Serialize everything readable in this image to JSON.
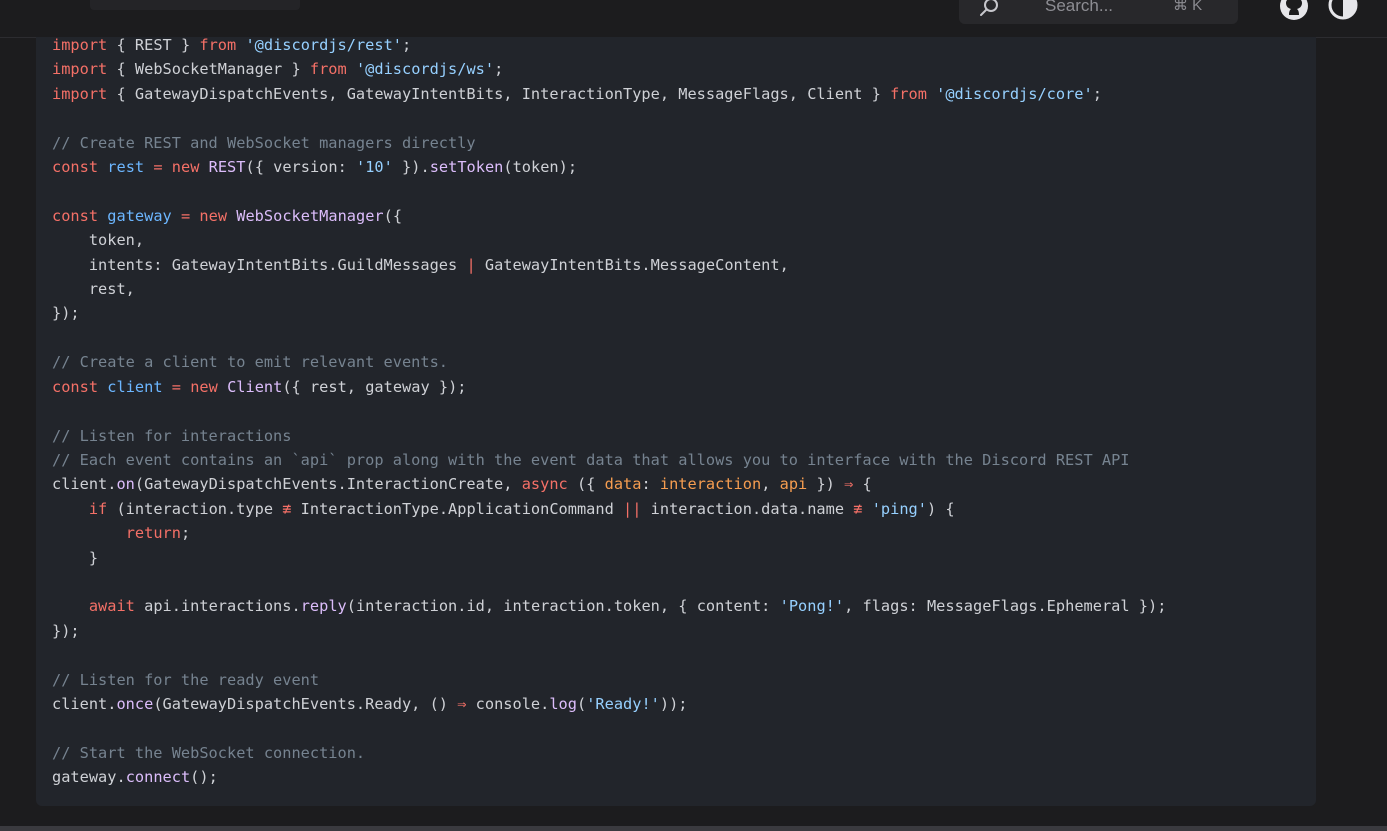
{
  "header": {
    "search_placeholder": "Search...",
    "search_shortcut": "⌘ K",
    "icons": [
      "search-icon",
      "github-icon",
      "theme-toggle-icon"
    ]
  },
  "colors": {
    "background": "#1c1c1e",
    "code_background": "#22252b",
    "keyword": "#f47067",
    "string": "#96d0ff",
    "function": "#dcbdfb",
    "variable": "#6cb6ff",
    "comment": "#768390",
    "parameter": "#f69d50",
    "text": "#cfd1d6"
  },
  "code": {
    "language": "javascript",
    "lines": [
      [
        [
          "kw",
          "import"
        ],
        [
          "plain",
          " { REST } "
        ],
        [
          "kw",
          "from"
        ],
        [
          "plain",
          " "
        ],
        [
          "str",
          "'@discordjs/rest'"
        ],
        [
          "plain",
          ";"
        ]
      ],
      [
        [
          "kw",
          "import"
        ],
        [
          "plain",
          " { WebSocketManager } "
        ],
        [
          "kw",
          "from"
        ],
        [
          "plain",
          " "
        ],
        [
          "str",
          "'@discordjs/ws'"
        ],
        [
          "plain",
          ";"
        ]
      ],
      [
        [
          "kw",
          "import"
        ],
        [
          "plain",
          " { GatewayDispatchEvents, GatewayIntentBits, InteractionType, MessageFlags, Client } "
        ],
        [
          "kw",
          "from"
        ],
        [
          "plain",
          " "
        ],
        [
          "str",
          "'@discordjs/core'"
        ],
        [
          "plain",
          ";"
        ]
      ],
      [],
      [
        [
          "cm",
          "// Create REST and WebSocket managers directly"
        ]
      ],
      [
        [
          "kw",
          "const"
        ],
        [
          "plain",
          " "
        ],
        [
          "var",
          "rest"
        ],
        [
          "plain",
          " "
        ],
        [
          "op",
          "="
        ],
        [
          "plain",
          " "
        ],
        [
          "kw",
          "new"
        ],
        [
          "plain",
          " "
        ],
        [
          "fn",
          "REST"
        ],
        [
          "plain",
          "({ version: "
        ],
        [
          "str",
          "'10'"
        ],
        [
          "plain",
          " })."
        ],
        [
          "fn",
          "setToken"
        ],
        [
          "plain",
          "(token);"
        ]
      ],
      [],
      [
        [
          "kw",
          "const"
        ],
        [
          "plain",
          " "
        ],
        [
          "var",
          "gateway"
        ],
        [
          "plain",
          " "
        ],
        [
          "op",
          "="
        ],
        [
          "plain",
          " "
        ],
        [
          "kw",
          "new"
        ],
        [
          "plain",
          " "
        ],
        [
          "fn",
          "WebSocketManager"
        ],
        [
          "plain",
          "({"
        ]
      ],
      [
        [
          "plain",
          "    token,"
        ]
      ],
      [
        [
          "plain",
          "    intents: GatewayIntentBits.GuildMessages "
        ],
        [
          "op",
          "|"
        ],
        [
          "plain",
          " GatewayIntentBits.MessageContent,"
        ]
      ],
      [
        [
          "plain",
          "    rest,"
        ]
      ],
      [
        [
          "plain",
          "});"
        ]
      ],
      [],
      [
        [
          "cm",
          "// Create a client to emit relevant events."
        ]
      ],
      [
        [
          "kw",
          "const"
        ],
        [
          "plain",
          " "
        ],
        [
          "var",
          "client"
        ],
        [
          "plain",
          " "
        ],
        [
          "op",
          "="
        ],
        [
          "plain",
          " "
        ],
        [
          "kw",
          "new"
        ],
        [
          "plain",
          " "
        ],
        [
          "fn",
          "Client"
        ],
        [
          "plain",
          "({ rest, gateway });"
        ]
      ],
      [],
      [
        [
          "cm",
          "// Listen for interactions"
        ]
      ],
      [
        [
          "cm",
          "// Each event contains an `api` prop along with the event data that allows you to interface with the Discord REST API"
        ]
      ],
      [
        [
          "plain",
          "client."
        ],
        [
          "fn",
          "on"
        ],
        [
          "plain",
          "(GatewayDispatchEvents.InteractionCreate, "
        ],
        [
          "kw",
          "async"
        ],
        [
          "plain",
          " ({ "
        ],
        [
          "param",
          "data"
        ],
        [
          "plain",
          ": "
        ],
        [
          "param",
          "interaction"
        ],
        [
          "plain",
          ", "
        ],
        [
          "param",
          "api"
        ],
        [
          "plain",
          " }) "
        ],
        [
          "op",
          "⇒"
        ],
        [
          "plain",
          " {"
        ]
      ],
      [
        [
          "plain",
          "    "
        ],
        [
          "kw",
          "if"
        ],
        [
          "plain",
          " (interaction.type "
        ],
        [
          "op",
          "≢"
        ],
        [
          "plain",
          " InteractionType.ApplicationCommand "
        ],
        [
          "op",
          "||"
        ],
        [
          "plain",
          " interaction.data.name "
        ],
        [
          "op",
          "≢"
        ],
        [
          "plain",
          " "
        ],
        [
          "str",
          "'ping'"
        ],
        [
          "plain",
          ") {"
        ]
      ],
      [
        [
          "plain",
          "        "
        ],
        [
          "kw",
          "return"
        ],
        [
          "plain",
          ";"
        ]
      ],
      [
        [
          "plain",
          "    }"
        ]
      ],
      [],
      [
        [
          "plain",
          "    "
        ],
        [
          "kw",
          "await"
        ],
        [
          "plain",
          " api.interactions."
        ],
        [
          "fn",
          "reply"
        ],
        [
          "plain",
          "(interaction.id, interaction.token, { content: "
        ],
        [
          "str",
          "'Pong!'"
        ],
        [
          "plain",
          ", flags: MessageFlags.Ephemeral });"
        ]
      ],
      [
        [
          "plain",
          "});"
        ]
      ],
      [],
      [
        [
          "cm",
          "// Listen for the ready event"
        ]
      ],
      [
        [
          "plain",
          "client."
        ],
        [
          "fn",
          "once"
        ],
        [
          "plain",
          "(GatewayDispatchEvents.Ready, () "
        ],
        [
          "op",
          "⇒"
        ],
        [
          "plain",
          " console."
        ],
        [
          "fn",
          "log"
        ],
        [
          "plain",
          "("
        ],
        [
          "str",
          "'Ready!'"
        ],
        [
          "plain",
          "));"
        ]
      ],
      [],
      [
        [
          "cm",
          "// Start the WebSocket connection."
        ]
      ],
      [
        [
          "plain",
          "gateway."
        ],
        [
          "fn",
          "connect"
        ],
        [
          "plain",
          "();"
        ]
      ]
    ]
  }
}
